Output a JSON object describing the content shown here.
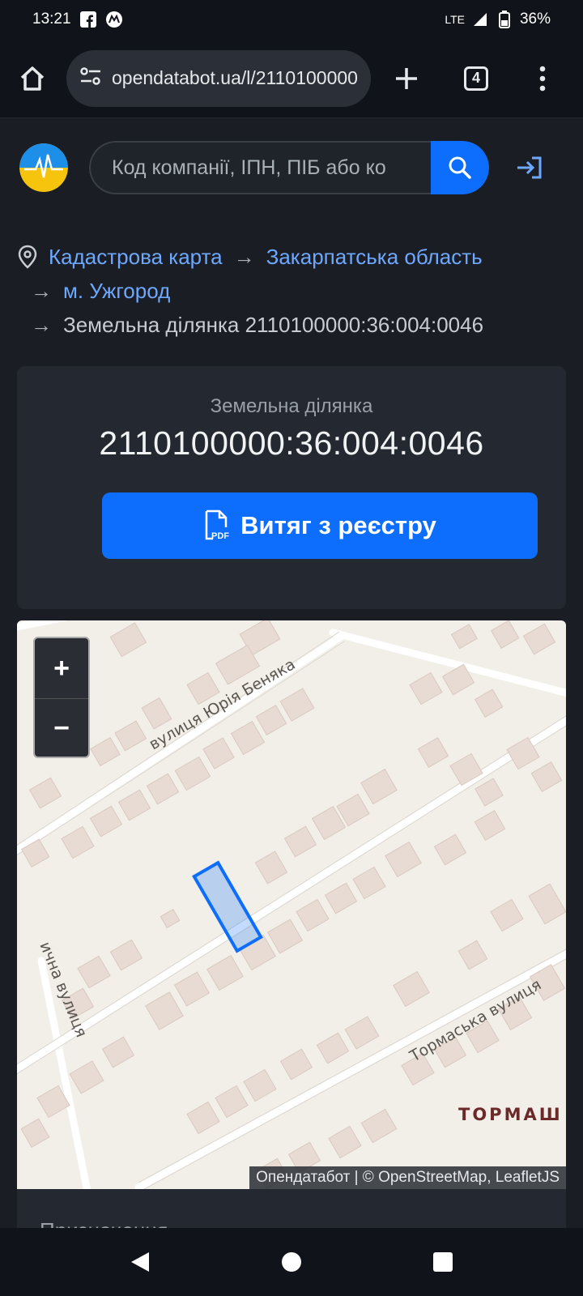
{
  "status_bar": {
    "time": "13:21",
    "network": "LTE",
    "battery": "36%"
  },
  "browser": {
    "url": "opendatabot.ua/l/2110100000",
    "tab_count": "4"
  },
  "header": {
    "search_placeholder": "Код компанії, ІПН, ПІБ або ко"
  },
  "breadcrumb": {
    "items": [
      {
        "label": "Кадастрова карта"
      },
      {
        "label": "Закарпатська область"
      },
      {
        "label": "м. Ужгород"
      },
      {
        "label": "Земельна ділянка 2110100000:36:004:0046"
      }
    ],
    "separator": "→"
  },
  "parcel_card": {
    "subtitle": "Земельна ділянка",
    "cadastral_number": "2110100000:36:004:0046",
    "registry_button_label": "Витяг з реєстру",
    "pdf_icon_text": "PDF"
  },
  "map": {
    "zoom_in_label": "+",
    "zoom_out_label": "−",
    "street_labels": [
      "вулиця Юрія Беняка",
      "Тормаська вулиця",
      "ична вулиця"
    ],
    "district_label": "ТОРМАШ",
    "attribution": "Опендатабот | © OpenStreetMap, LeafletJS"
  },
  "next_section": {
    "label": "Призначення"
  },
  "colors": {
    "accent": "#0d6efd",
    "link": "#6ea8fe",
    "background": "#1a1e24",
    "card": "#242830"
  }
}
